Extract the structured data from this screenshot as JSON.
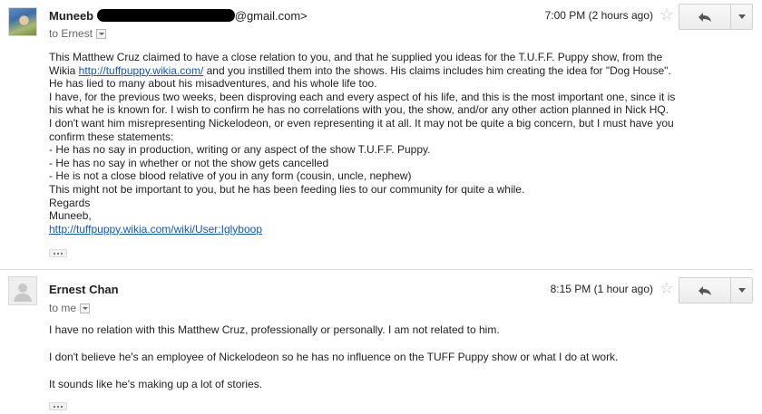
{
  "messages": [
    {
      "sender_name": "Muneeb",
      "sender_email_suffix": "@gmail.com>",
      "recipient": "to Ernest",
      "timestamp": "7:00 PM (2 hours ago)",
      "body_lines": [
        {
          "text": "This Matthew Cruz claimed to have a close relation to you, and that he supplied you ideas for the T.U.F.F. Puppy show, from the"
        },
        {
          "pre": "Wikia ",
          "link": "http://tuffpuppy.wikia.com/",
          "post": " and you instilled them into the shows. His claims includes him creating the idea for \"Dog House\"."
        },
        {
          "text": "He has lied to many about his misadventures, and his whole life too."
        },
        {
          "text": "I have, for the previous two weeks, been disproving each and every aspect of his life, and this is the most important one, since it is"
        },
        {
          "text": "his what he is known for. I wish to confirm he has no correlations with you, the show, and/or any other action planned in Nick HQ."
        },
        {
          "text": "I don't want him misrepresenting Nickelodeon, or even representing it at all. It may not be quite a big concern, but I must have you"
        },
        {
          "text": "confirm these statements:"
        },
        {
          "text": "- He has no say in production, writing or any aspect of the show T.U.F.F. Puppy."
        },
        {
          "text": "- He has no say in whether or not the show gets cancelled"
        },
        {
          "text": "- He is not a close blood relative of you in any form (cousin, uncle, nephew)"
        },
        {
          "text": "This might not be important to you, but he has been feeding lies to our community for quite a while."
        },
        {
          "text": "Regards"
        },
        {
          "text": "Muneeb,"
        },
        {
          "link": "http://tuffpuppy.wikia.com/wiki/User:Iglyboop"
        }
      ]
    },
    {
      "sender_name": "Ernest Chan",
      "recipient": "to me",
      "timestamp": "8:15 PM (1 hour ago)",
      "paragraphs": [
        "I have no relation with this Matthew Cruz, professionally or personally.  I am not related to him.",
        "I don't believe he's an employee of Nickelodeon so he has no influence on the TUFF Puppy show or what I do at work.",
        "It sounds like he's making up a lot of stories."
      ]
    }
  ],
  "icons": {
    "star": "star-icon",
    "reply": "reply-arrow-icon",
    "more": "chevron-down-icon",
    "avatar_default": "person-silhouette-icon"
  },
  "colors": {
    "link": "#1155cc",
    "star": "#c6c6c6",
    "divider": "#d6d6d6"
  }
}
